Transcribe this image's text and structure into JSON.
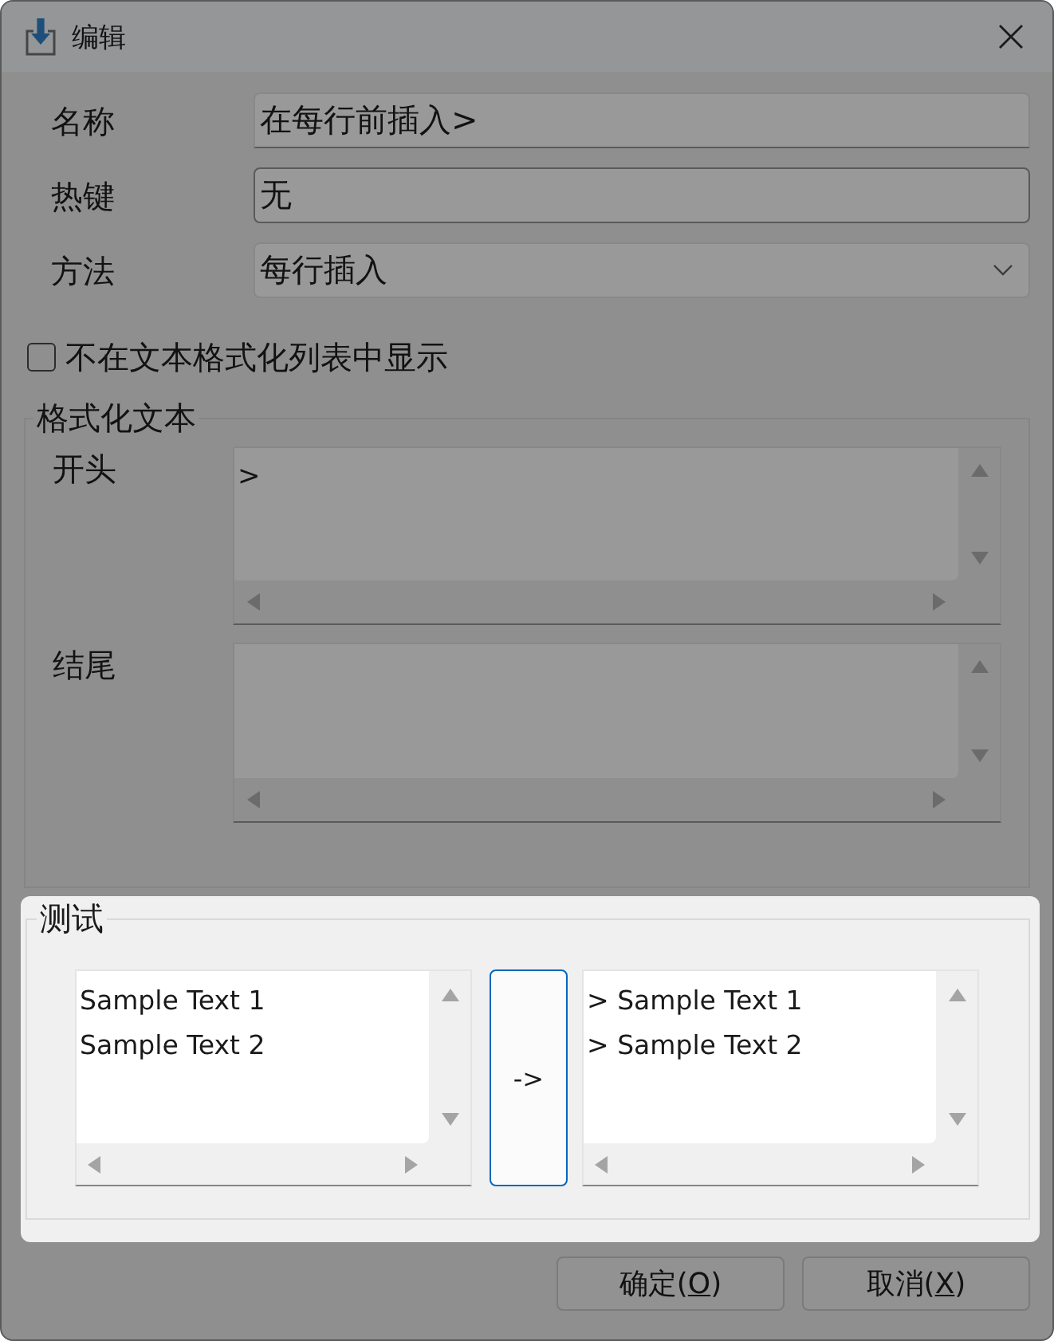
{
  "window": {
    "title": "编辑"
  },
  "fields": [
    {
      "kind": "text",
      "label": "名称",
      "value": "在每行前插入>"
    },
    {
      "kind": "hotkey",
      "label": "热键",
      "value": "无"
    },
    {
      "kind": "dropdown",
      "label": "方法",
      "value": "每行插入"
    }
  ],
  "checkbox": {
    "label": "不在文本格式化列表中显示",
    "checked": false
  },
  "format_group": {
    "title": "格式化文本",
    "highlighted": false,
    "text_areas": [
      {
        "label": "开头",
        "lines": [
          ">"
        ]
      },
      {
        "label": "结尾"
      }
    ]
  },
  "test_group": {
    "title": "测试",
    "highlighted": true,
    "input": {
      "lines": [
        "Sample Text 1",
        "Sample Text 2"
      ]
    },
    "convert_button": "->",
    "output": {
      "lines": [
        "> Sample Text 1",
        "> Sample Text 2"
      ]
    }
  },
  "buttons": [
    {
      "text": "确定(",
      "access_key": "O",
      "text_after": ")"
    },
    {
      "text": "取消(",
      "access_key": "X",
      "text_after": ")"
    }
  ]
}
